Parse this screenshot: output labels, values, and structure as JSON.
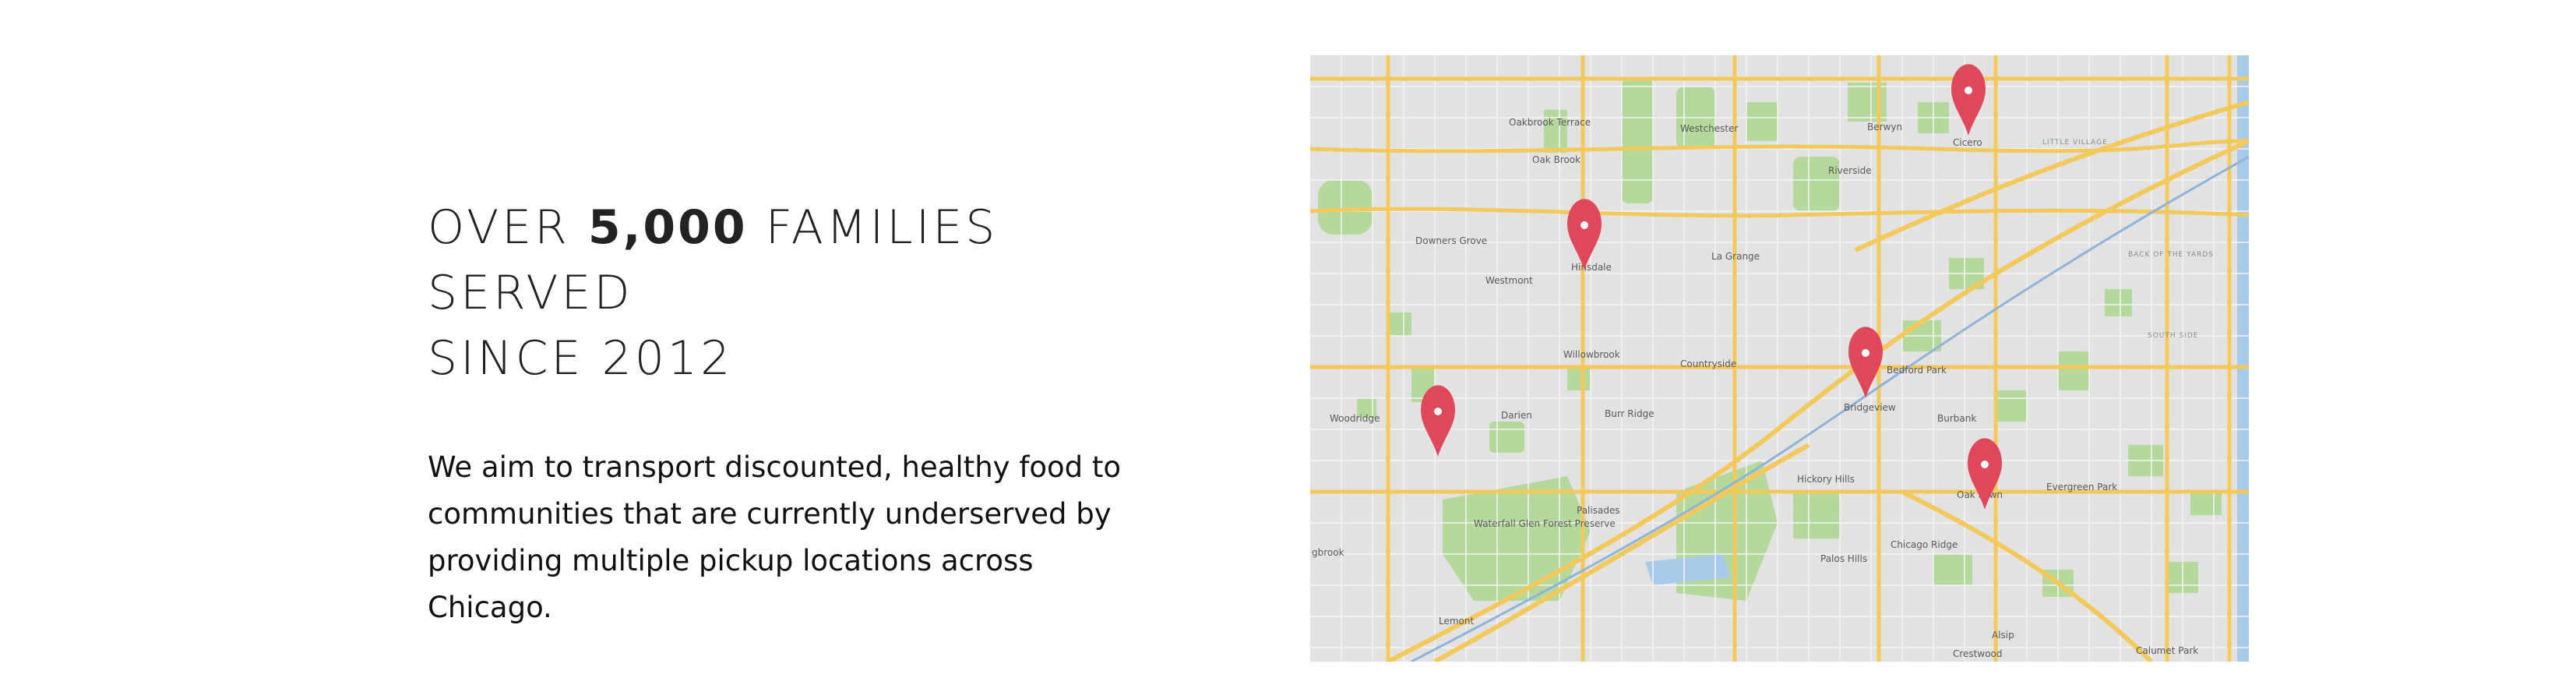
{
  "headline": {
    "prefix": "OVER ",
    "number": "5,000",
    "suffix": " FAMILIES SERVED",
    "line2": "SINCE 2012"
  },
  "description": {
    "line1": "We aim to transport discounted, healthy food to",
    "line2": "communities that are currently underserved by",
    "line3": "providing multiple pickup locations across Chicago."
  },
  "map": {
    "labels": {
      "oakbrook_terrace": "Oakbrook Terrace",
      "oak_brook": "Oak Brook",
      "westchester": "Westchester",
      "berwyn": "Berwyn",
      "cicero": "Cicero",
      "little_village": "LITTLE VILLAGE",
      "riverside": "Riverside",
      "downers_grove": "Downers Grove",
      "hinsdale": "Hinsdale",
      "la_grange": "La Grange",
      "back_of_the_yards": "BACK OF THE YARDS",
      "westmont": "Westmont",
      "south_side": "SOUTH SIDE",
      "willowbrook": "Willowbrook",
      "countryside": "Countryside",
      "bedford_park": "Bedford Park",
      "woodridge": "Woodridge",
      "darien": "Darien",
      "burr_ridge": "Burr Ridge",
      "bridgeview": "Bridgeview",
      "burbank": "Burbank",
      "hickory_hills": "Hickory Hills",
      "oak_lawn": "Oak Lawn",
      "evergreen_park": "Evergreen Park",
      "waterfall_glen": "Waterfall Glen Forest Preserve",
      "palisades": "Palisades",
      "chicago_ridge": "Chicago Ridge",
      "bolingbrook": "gbrook",
      "palos_hills": "Palos Hills",
      "lemont": "Lemont",
      "alsip": "Alsip",
      "crestwood": "Crestwood",
      "calumet_park": "Calumet Park"
    },
    "pin_color": "#e0475b",
    "pins": [
      "Cicero",
      "Hinsdale",
      "Bridgeview",
      "Darien",
      "Oak Lawn"
    ]
  }
}
